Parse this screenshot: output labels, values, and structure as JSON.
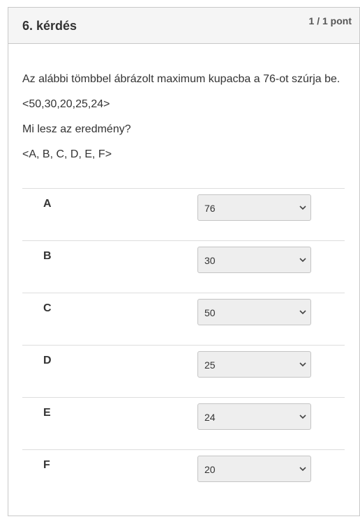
{
  "question": {
    "title": "6. kérdés",
    "points": "1 / 1 pont",
    "text_lines": [
      "Az alábbi tömbbel ábrázolt maximum kupacba a 76-ot szúrja be.",
      "<50,30,20,25,24>",
      "Mi lesz az eredmény?",
      "<A, B, C, D, E, F>"
    ]
  },
  "answers": [
    {
      "label": "A",
      "selected": "76"
    },
    {
      "label": "B",
      "selected": "30"
    },
    {
      "label": "C",
      "selected": "50"
    },
    {
      "label": "D",
      "selected": "25"
    },
    {
      "label": "E",
      "selected": "24"
    },
    {
      "label": "F",
      "selected": "20"
    }
  ],
  "icons": {
    "dropdown": "chevron-down-icon"
  }
}
